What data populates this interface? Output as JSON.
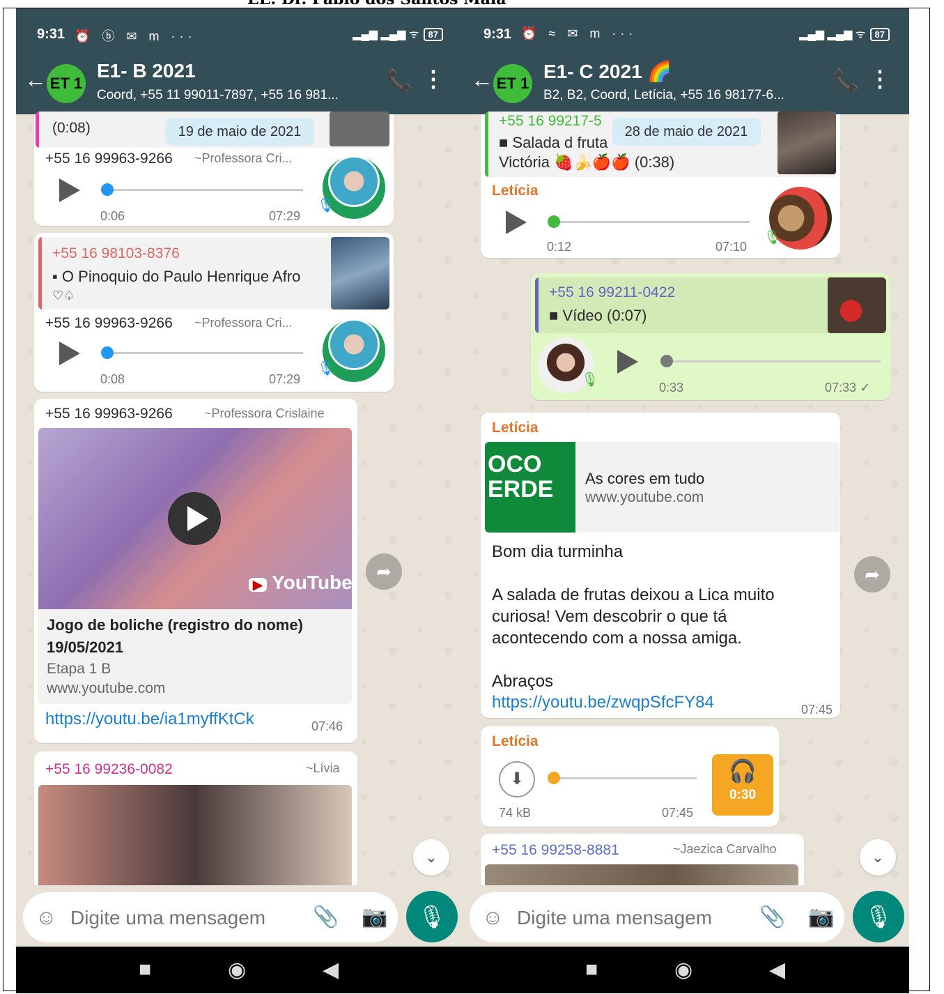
{
  "page_title": "EE. Dr. Pablo dos Santos Maia",
  "left": {
    "status": {
      "time": "9:31",
      "left_icons": "⏰ ⓑ ✉ m ···",
      "right_icons": "▂▄▆ ▂▄▆ ᯤ",
      "battery": "87"
    },
    "header": {
      "avatar": "ET 1",
      "title": "E1- B 2021",
      "subtitle": "Coord, +55 11 99011-7897, +55 16 981..."
    },
    "date_pill": "19 de maio de 2021",
    "msg1": {
      "duration_quote": "(0:08)",
      "sender": "+55 16 99963-9266",
      "alias": "~Professora Cri...",
      "duration": "0:06",
      "time": "07:29"
    },
    "msg2": {
      "quote_sender": "+55 16 98103-8376",
      "quote_text": "O Pinoquio do Paulo Henrique Afro",
      "quote_text2": "♡♤",
      "sender": "+55 16 99963-9266",
      "alias": "~Professora Cri...",
      "duration": "0:08",
      "time": "07:29"
    },
    "msg3": {
      "sender": "+55 16 99963-9266",
      "alias": "~Professora Crislaine",
      "yt_brand": "YouTube",
      "title": "Jogo de boliche (registro do nome)",
      "date": "19/05/2021",
      "subtitle": "Etapa 1 B",
      "domain": "www.youtube.com",
      "link": "https://youtu.be/ia1myffKtCk",
      "time": "07:46"
    },
    "msg4": {
      "sender": "+55 16 99236-0082",
      "alias": "~Lívia"
    },
    "composer": {
      "placeholder": "Digite uma mensagem"
    }
  },
  "right": {
    "status": {
      "time": "9:31",
      "left_icons": "⏰ ≈ ✉ m ···",
      "right_icons": "▂▄▆ ▂▄▆ ᯤ",
      "battery": "87"
    },
    "header": {
      "avatar": "ET 1",
      "title": "E1- C 2021 🌈",
      "subtitle": "B2, B2, Coord, Letícia, +55 16 98177-6..."
    },
    "date_pill": "28 de maio de 2021",
    "msg1": {
      "quote_sender": "+55 16 99217-5",
      "quote_text": "Salada d fruta",
      "quote_text2": "Victória 🍓🍌🍎🍎 (0:38)",
      "sender": "Letícia",
      "duration": "0:12",
      "time": "07:10"
    },
    "msg2": {
      "quote_sender": "+55 16 99211-0422",
      "quote_text": "Vídeo (0:07)",
      "duration": "0:33",
      "time": "07:33 ✓"
    },
    "msg3": {
      "sender": "Letícia",
      "thumb_text": "OCO\nERDE",
      "link_title": "As cores em tudo",
      "link_domain": "www.youtube.com",
      "line1": "Bom dia turminha",
      "line2": "A salada de frutas deixou a Lica muito",
      "line3": "curiosa! Vem descobrir o que tá",
      "line4": "acontecendo com a nossa amiga.",
      "line5": "Abraços",
      "link": "https://youtu.be/zwqpSfcFY84",
      "time": "07:45"
    },
    "msg4": {
      "sender": "Letícia",
      "size": "74 kB",
      "time": "07:45",
      "duration": "0:30"
    },
    "msg5": {
      "sender": "+55 16 99258-8881",
      "alias": "~Jaezica Carvalho"
    },
    "composer": {
      "placeholder": "Digite uma mensagem"
    }
  },
  "colors": {
    "header": "#344e58",
    "accent": "#00897b",
    "out_bubble": "#e0f8c6",
    "green_dot": "#3fbd3a",
    "blue_dot": "#2196f3",
    "orange": "#f5a623"
  }
}
